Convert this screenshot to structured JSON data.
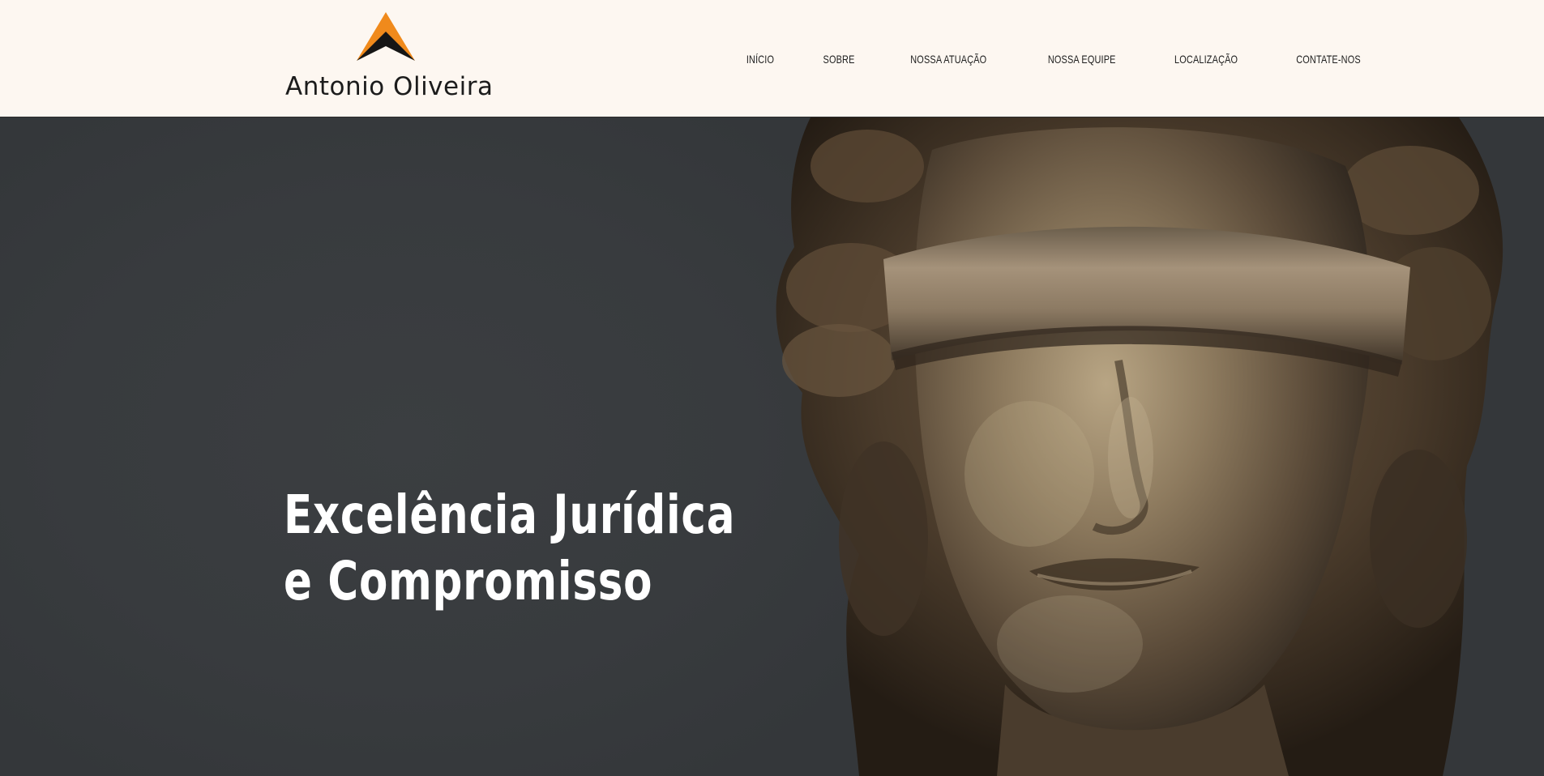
{
  "brand": {
    "name": "Antonio Oliveira",
    "logo_icon": "chevron-peak-logo",
    "accent_color": "#f08a1c",
    "dark_color": "#1a1a1a"
  },
  "nav": {
    "items": [
      {
        "label": "INÍCIO"
      },
      {
        "label": "SOBRE"
      },
      {
        "label": "NOSSA ATUAÇÃO"
      },
      {
        "label": "NOSSA EQUIPE"
      },
      {
        "label": "LOCALIZAÇÃO"
      },
      {
        "label": "CONTATE-NOS"
      }
    ]
  },
  "hero": {
    "title_line1": "Excelência Jurídica",
    "title_line2": "e Compromisso",
    "background_color": "#3a3d40",
    "image": "blindfolded-lady-justice-statue"
  },
  "colors": {
    "header_bg": "#fdf7f1",
    "text_dark": "#1d1d1d",
    "hero_text": "#ffffff",
    "bronze": "#9c8466"
  }
}
